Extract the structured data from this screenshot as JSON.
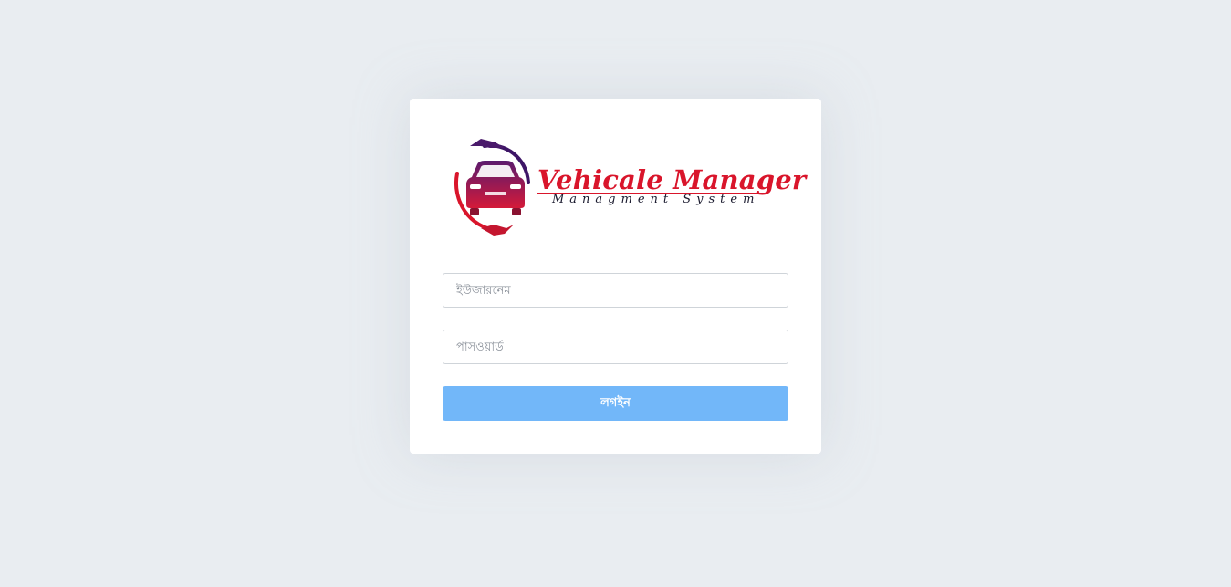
{
  "logo": {
    "title": "Vehicale Manager",
    "subtitle": "Managment System",
    "icon": "car-in-hands-icon"
  },
  "form": {
    "username_placeholder": "ইউজারনেম",
    "password_placeholder": "পাসওয়ার্ড",
    "login_label": "লগইন"
  },
  "colors": {
    "page_background": "#e9edf1",
    "card_background": "#ffffff",
    "brand_red": "#d9152b",
    "brand_purple": "#4a1a6b",
    "button_blue": "#72b7f9"
  }
}
